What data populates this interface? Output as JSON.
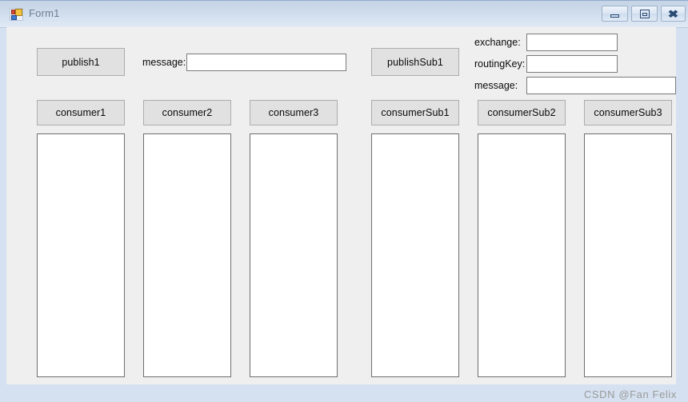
{
  "window": {
    "title": "Form1",
    "icon": "winforms-icon",
    "caption_buttons": [
      {
        "name": "minimize",
        "glyph": "minimize-icon"
      },
      {
        "name": "maximize",
        "glyph": "restore-icon"
      },
      {
        "name": "close",
        "glyph": "close-icon"
      }
    ]
  },
  "colors": {
    "titlebar_top": "#c5d4e6",
    "titlebar_bottom": "#e0e9f4",
    "frame": "#d5e1f0",
    "client_background": "#efeff0",
    "button_face": "#e1e1e1",
    "button_border": "#adadad",
    "textbox_border": "#7a7a7a",
    "listbox_border": "#6e6e6e",
    "text": "#0a0a0a",
    "title_text": "#6d7f92",
    "watermark": "#9a9a9a"
  },
  "left_panel": {
    "publish_button": "publish1",
    "message_label": "message:",
    "message_value": "",
    "message_placeholder": "",
    "consumer_buttons": [
      "consumer1",
      "consumer2",
      "consumer3"
    ],
    "consumer_lists": [
      {
        "name": "consumer1-list",
        "items": []
      },
      {
        "name": "consumer2-list",
        "items": []
      },
      {
        "name": "consumer3-list",
        "items": []
      }
    ]
  },
  "right_panel": {
    "publish_button": "publishSub1",
    "fields": [
      {
        "label": "exchange:",
        "value": "",
        "placeholder": ""
      },
      {
        "label": "routingKey:",
        "value": "",
        "placeholder": ""
      },
      {
        "label": "message:",
        "value": "",
        "placeholder": ""
      }
    ],
    "consumer_buttons": [
      "consumerSub1",
      "consumerSub2",
      "consumerSub3"
    ],
    "consumer_lists": [
      {
        "name": "consumerSub1-list",
        "items": []
      },
      {
        "name": "consumerSub2-list",
        "items": []
      },
      {
        "name": "consumerSub3-list",
        "items": []
      }
    ]
  },
  "watermark": "CSDN @Fan Felix"
}
